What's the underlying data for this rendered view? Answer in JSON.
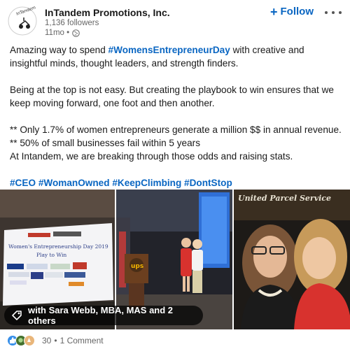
{
  "post": {
    "company_name": "InTandem Promotions, Inc.",
    "followers": "1,136 followers",
    "time_ago": "11mo •",
    "follow_label": "Follow",
    "follow_icon": "+"
  },
  "body": {
    "line1_pre": "Amazing way to spend ",
    "line1_tag": "#WomensEntrepreneurDay",
    "line1_post": " with creative and insightful minds, thought leaders, and strength finders.",
    "para2": "Being at the top is not easy. But creating the playbook to win ensures that we keep moving forward, one foot and then another.",
    "stat1": "** Only 1.7% of women entrepreneurs generate a million $$ in annual revenue.",
    "stat2": "** 50% of small businesses fail within 5 years",
    "stat3": "At Intandem, we are breaking through those odds and raising stats.",
    "hashtags": [
      "#CEO",
      "#WomanOwned",
      "#KeepClimbing",
      "#DontStop"
    ]
  },
  "photos": {
    "slide_title": "Women's Entrepreneurship Day 2019",
    "slide_subtitle": "Play to Win",
    "sign_text": "United Parcel Service",
    "tagged_label": "with Sara Webb, MBA, MAS and 2 others"
  },
  "social": {
    "reaction_count": "30",
    "separator": "•",
    "comments": "1 Comment"
  },
  "colors": {
    "link": "#0a66c2",
    "text": "#191919",
    "muted": "#666666"
  }
}
